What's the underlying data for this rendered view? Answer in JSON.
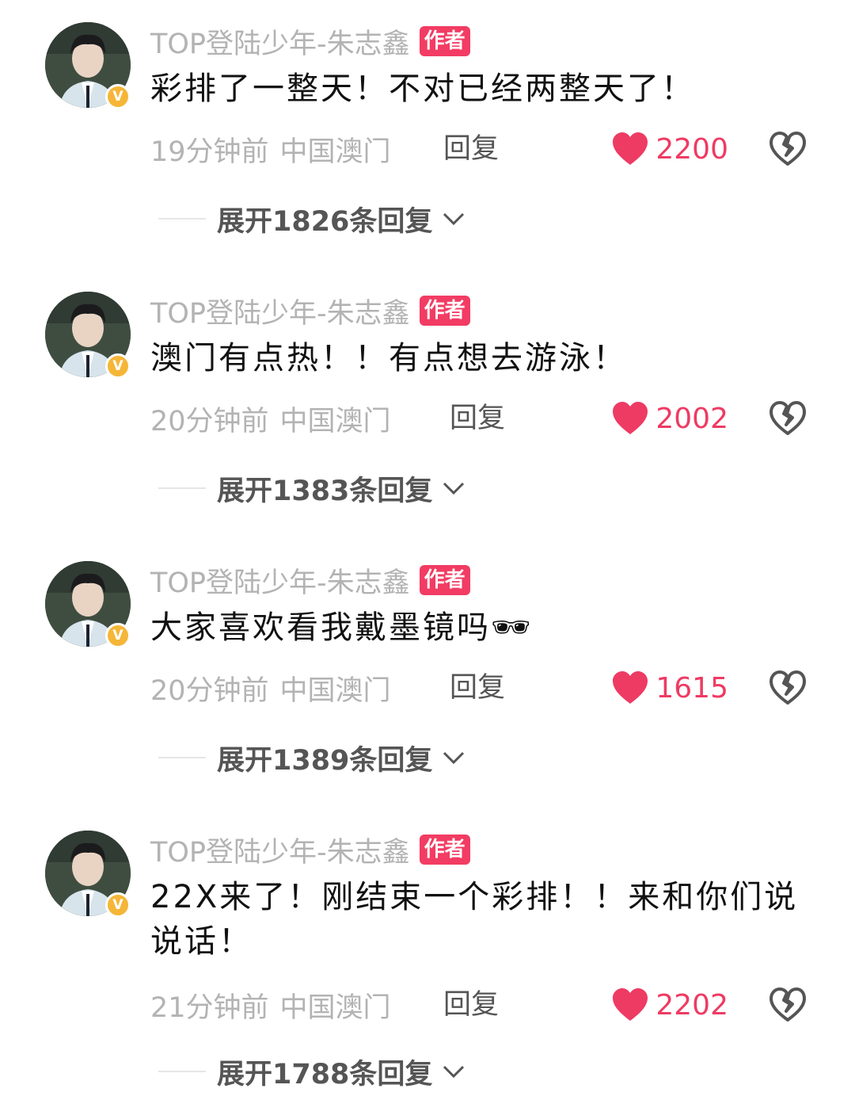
{
  "colors": {
    "accent_pink": "#ee3b63",
    "badge_pink": "#f23c63",
    "verified_gold": "#f5b638",
    "meta_gray": "#b3b3b3"
  },
  "comments": [
    {
      "username": "TOP登陆少年-朱志鑫",
      "badge": "作者",
      "verified_mark": "V",
      "text": "彩排了一整天！不对已经两整天了！",
      "time": "19分钟前",
      "location": "中国澳门",
      "reply_label": "回复",
      "likes": "2200",
      "expand_label": "展开1826条回复",
      "icons": [
        "avatar",
        "verified-badge-icon",
        "heart-icon",
        "broken-heart-icon",
        "chevron-down-icon"
      ]
    },
    {
      "username": "TOP登陆少年-朱志鑫",
      "badge": "作者",
      "verified_mark": "V",
      "text": "澳门有点热！！有点想去游泳！",
      "time": "20分钟前",
      "location": "中国澳门",
      "reply_label": "回复",
      "likes": "2002",
      "expand_label": "展开1383条回复"
    },
    {
      "username": "TOP登陆少年-朱志鑫",
      "badge": "作者",
      "verified_mark": "V",
      "text": "大家喜欢看我戴墨镜吗🕶",
      "time": "20分钟前",
      "location": "中国澳门",
      "reply_label": "回复",
      "likes": "1615",
      "expand_label": "展开1389条回复"
    },
    {
      "username": "TOP登陆少年-朱志鑫",
      "badge": "作者",
      "verified_mark": "V",
      "text": "22X来了！刚结束一个彩排！！来和你们说说话！",
      "time": "21分钟前",
      "location": "中国澳门",
      "reply_label": "回复",
      "likes": "2202",
      "expand_label": "展开1788条回复"
    }
  ]
}
